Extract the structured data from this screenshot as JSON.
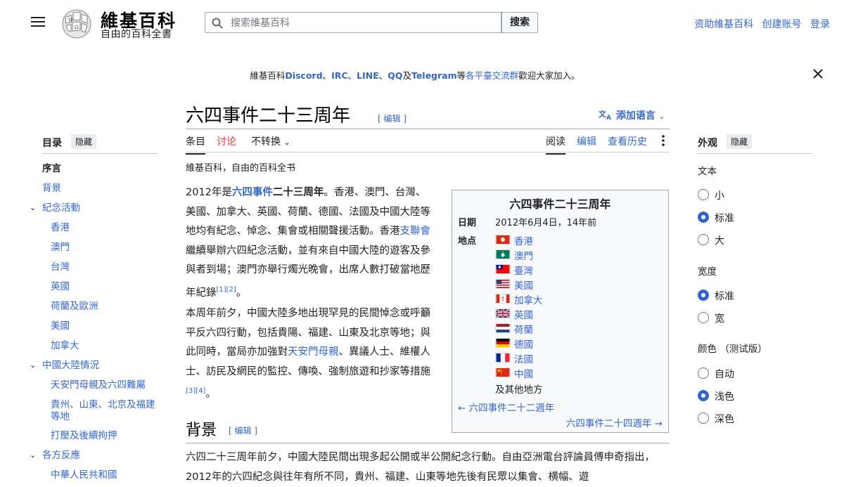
{
  "header": {
    "wordmark": "維基百科",
    "tagline": "自由的百科全書",
    "search_placeholder": "搜索維基百科",
    "search_button": "搜索",
    "user_links": [
      "资助維基百科",
      "创建账号",
      "登录"
    ]
  },
  "notice": {
    "prefix": "維基百科",
    "discord": "Discord",
    "sep1": "、",
    "irc": "IRC",
    "sep2": "、",
    "line": "LINE",
    "sep3": "、",
    "qq": "QQ",
    "and": "及",
    "telegram": "Telegram",
    "mid": "等",
    "link": "各平臺交流群",
    "suffix": "歡迎大家加入。"
  },
  "page": {
    "title": "六四事件二十三周年",
    "edit_label": "[ 编辑 ]",
    "add_languages": "添加语言",
    "site_sub": "維基百科，自由的百科全书"
  },
  "tabs": {
    "article": "条目",
    "talk": "讨论",
    "variant": "不转换",
    "read": "阅读",
    "edit": "编辑",
    "history": "查看历史"
  },
  "toc": {
    "title": "目录",
    "hide": "隐藏",
    "items": [
      {
        "label": "序言"
      },
      {
        "label": "背景"
      },
      {
        "label": "紀念活動"
      },
      {
        "label": "香港"
      },
      {
        "label": "澳門"
      },
      {
        "label": "台灣"
      },
      {
        "label": "英國"
      },
      {
        "label": "荷蘭及歐洲"
      },
      {
        "label": "美國"
      },
      {
        "label": "加拿大"
      },
      {
        "label": "中國大陸情況"
      },
      {
        "label": "天安門母親及六四難屬"
      },
      {
        "label": "貴州、山東、北京及福建等地"
      },
      {
        "label": "打壓及後續拘押"
      },
      {
        "label": "各方反應"
      },
      {
        "label": "中華人民共和國"
      }
    ]
  },
  "body": {
    "p1_year": "2012年是",
    "p1_link": "六四事件",
    "p1_bold": "二十三周年",
    "p1_a": "。香港、澳門、台灣、美國、加拿大、英國、荷蘭、德國、法國及中國大陸等地均有紀念、悼念、集會或相關聲援活動。香港",
    "p1_link2": "支聯會",
    "p1_b": "繼續舉辦六四紀念活動，並有來自中國大陸的遊客及參與者到場；澳門亦舉行燭光晚會，出席人數打破當地歷年紀錄",
    "p1_ref": "[1][2]",
    "p1_end": "。",
    "p2_a": "本周年前夕，中國大陸多地出現罕見的民間悼念或呼籲平反六四行動，包括貴陽、福建、山東及北京等地；與此同時，當局亦加強對",
    "p2_link": "天安門母親",
    "p2_b": "、異議人士、維權人士、訪民及網民的監控、傳喚、強制旅遊和抄家等措施",
    "p2_ref": "[3][4]",
    "p2_end": "。",
    "section_title": "背景",
    "section_para": "六四二十三周年前夕，中國大陸民間出現多起公開或半公開紀念行動。自由亞洲電台評論員傅申奇指出，2012年的六四紀念與往年有所不同，貴州、福建、山東等地先後有民眾以集會、横幅、遊"
  },
  "infobox": {
    "title": "六四事件二十三周年",
    "date_label": "日期",
    "date_value": "2012年6月4日，14年前",
    "place_label": "地点",
    "places": [
      {
        "name": "香港",
        "flag": "hk-flag-icon"
      },
      {
        "name": "澳門",
        "flag": "macau-flag-icon"
      },
      {
        "name": "臺灣",
        "flag": "taiwan-flag-icon"
      },
      {
        "name": "美國",
        "flag": "usa-flag-icon"
      },
      {
        "name": "加拿大",
        "flag": "canada-flag-icon"
      },
      {
        "name": "英國",
        "flag": "uk-flag-icon"
      },
      {
        "name": "荷蘭",
        "flag": "netherlands-flag-icon"
      },
      {
        "name": "德國",
        "flag": "germany-flag-icon"
      },
      {
        "name": "法國",
        "flag": "france-flag-icon"
      },
      {
        "name": "中國",
        "flag": "china-flag-icon"
      }
    ],
    "others": "及其他地方",
    "prev": "← 六四事件二十二週年",
    "next": "六四事件二十四週年 →"
  },
  "appearance": {
    "title": "外观",
    "hide": "隐藏",
    "text_label": "文本",
    "text_options": [
      "小",
      "标准",
      "大"
    ],
    "text_selected": "标准",
    "width_label": "宽度",
    "width_options": [
      "标准",
      "宽"
    ],
    "width_selected": "标准",
    "color_label": "颜色 （测试版）",
    "color_options": [
      "自动",
      "浅色",
      "深色"
    ],
    "color_selected": "浅色"
  },
  "colors": {
    "link": "#3366cc",
    "talk_red": "#d33",
    "infobox_bg": "#f8f9fa"
  }
}
